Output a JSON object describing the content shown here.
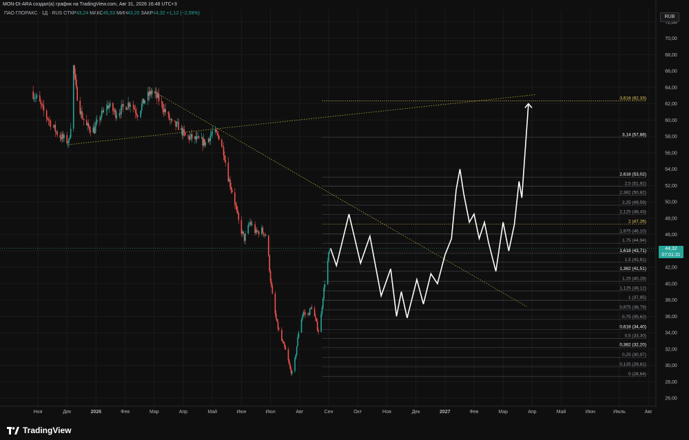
{
  "header": {
    "attribution": "MON-DI-ARA создал(а) график на TradingView.com, Авг 31, 2026 16:48 UTC+3"
  },
  "legend": {
    "symbol": "ПАО ГЛОРАКС · 1Д · RUS",
    "open_label": "ОТКР",
    "open": "43,24",
    "high_label": "МАКС",
    "high": "45,53",
    "low_label": "МИН",
    "low": "43,20",
    "close_label": "ЗАКР",
    "close": "44,32",
    "change": "+1,12 (+2,59%)"
  },
  "currency_button": "RUB",
  "price_badge": {
    "price": "44,32",
    "countdown": "07:01:31"
  },
  "footer": {
    "brand": "TradingView"
  },
  "colors": {
    "up": "#26a69a",
    "down": "#ef5350",
    "background": "#0f0f0f",
    "fib_gold": "#f0d060",
    "trend": "#b9b340",
    "projection": "#ffffff"
  },
  "chart_data": {
    "type": "candlestick",
    "y_axis": {
      "min": 25,
      "max": 73.5,
      "ticks": [
        "72,00",
        "70,00",
        "68,00",
        "66,00",
        "64,00",
        "62,00",
        "60,00",
        "58,00",
        "56,00",
        "54,00",
        "52,00",
        "50,00",
        "48,00",
        "46,00",
        "44,00",
        "42,00",
        "40,00",
        "38,00",
        "36,00",
        "34,00",
        "32,00",
        "30,00",
        "28,00",
        "26,00"
      ],
      "tick_values": [
        72,
        70,
        68,
        66,
        64,
        62,
        60,
        58,
        56,
        54,
        52,
        50,
        48,
        46,
        44,
        42,
        40,
        38,
        36,
        34,
        32,
        30,
        28,
        26
      ]
    },
    "x_axis": {
      "labels": [
        "Ноя",
        "Дек",
        "2026",
        "Фев",
        "Мар",
        "Апр",
        "Май",
        "Июн",
        "Июл",
        "Авг",
        "Сен",
        "Окт",
        "Ноя",
        "Дек",
        "2027",
        "Фев",
        "Мар",
        "Апр",
        "Май",
        "Июн",
        "Июль",
        "Авг"
      ],
      "label_months": [
        0,
        1,
        2,
        3,
        4,
        5,
        6,
        7,
        8,
        9,
        10,
        11,
        12,
        13,
        14,
        15,
        16,
        17,
        18,
        19,
        20,
        21
      ],
      "bold_labels": [
        "2026",
        "2027"
      ],
      "month_start": "2025-11",
      "month_end": "2027-08"
    },
    "price_path": [
      [
        "2025-10-25",
        63.5
      ],
      [
        "2025-11-01",
        62.5
      ],
      [
        "2025-11-08",
        60.8
      ],
      [
        "2025-11-15",
        59.5
      ],
      [
        "2025-11-22",
        58.2
      ],
      [
        "2025-11-29",
        57.6
      ],
      [
        "2025-12-03",
        57.3
      ],
      [
        "2025-12-06",
        60.5
      ],
      [
        "2025-12-08",
        66.5
      ],
      [
        "2025-12-11",
        63.5
      ],
      [
        "2025-12-16",
        60.8
      ],
      [
        "2025-12-22",
        59.2
      ],
      [
        "2025-12-30",
        58.8
      ],
      [
        "2026-01-06",
        60.5
      ],
      [
        "2026-01-14",
        61.8
      ],
      [
        "2026-01-22",
        60.8
      ],
      [
        "2026-01-30",
        61.5
      ],
      [
        "2026-02-06",
        62.2
      ],
      [
        "2026-02-13",
        60.8
      ],
      [
        "2026-02-20",
        62.5
      ],
      [
        "2026-02-27",
        63.5
      ],
      [
        "2026-03-06",
        62.5
      ],
      [
        "2026-03-13",
        61.0
      ],
      [
        "2026-03-20",
        59.5
      ],
      [
        "2026-03-27",
        59.2
      ],
      [
        "2026-04-03",
        58.0
      ],
      [
        "2026-04-10",
        57.8
      ],
      [
        "2026-04-17",
        57.5
      ],
      [
        "2026-04-24",
        57.2
      ],
      [
        "2026-05-01",
        58.5
      ],
      [
        "2026-05-08",
        58.0
      ],
      [
        "2026-05-13",
        56.2
      ],
      [
        "2026-05-18",
        53.0
      ],
      [
        "2026-05-24",
        50.5
      ],
      [
        "2026-05-30",
        47.0
      ],
      [
        "2026-06-04",
        45.5
      ],
      [
        "2026-06-10",
        47.5
      ],
      [
        "2026-06-16",
        46.2
      ],
      [
        "2026-06-22",
        46.5
      ],
      [
        "2026-06-27",
        45.8
      ],
      [
        "2026-07-01",
        40.5
      ],
      [
        "2026-07-04",
        37.5
      ],
      [
        "2026-07-08",
        35.0
      ],
      [
        "2026-07-13",
        33.0
      ],
      [
        "2026-07-18",
        31.5
      ],
      [
        "2026-07-22",
        29.5
      ],
      [
        "2026-07-25",
        28.8
      ],
      [
        "2026-07-28",
        31.5
      ],
      [
        "2026-08-01",
        35.0
      ],
      [
        "2026-08-05",
        36.5
      ],
      [
        "2026-08-09",
        36.0
      ],
      [
        "2026-08-14",
        37.2
      ],
      [
        "2026-08-18",
        35.5
      ],
      [
        "2026-08-22",
        33.8
      ],
      [
        "2026-08-26",
        38.5
      ],
      [
        "2026-08-29",
        41.0
      ],
      [
        "2026-09-01",
        43.5
      ],
      [
        "2026-09-03",
        44.32
      ]
    ],
    "last_price": 44.32,
    "fib_levels": [
      {
        "ratio": "0",
        "price": "28,64",
        "value": 28.64,
        "emphasis": "normal"
      },
      {
        "ratio": "0,125",
        "price": "29,81",
        "value": 29.81,
        "emphasis": "normal"
      },
      {
        "ratio": "0,25",
        "price": "30,97",
        "value": 30.97,
        "emphasis": "normal"
      },
      {
        "ratio": "0,382",
        "price": "32,20",
        "value": 32.2,
        "emphasis": "bold"
      },
      {
        "ratio": "0,5",
        "price": "33,30",
        "value": 33.3,
        "emphasis": "normal"
      },
      {
        "ratio": "0,618",
        "price": "34,40",
        "value": 34.4,
        "emphasis": "bold"
      },
      {
        "ratio": "0,75",
        "price": "35,62",
        "value": 35.62,
        "emphasis": "normal"
      },
      {
        "ratio": "0,875",
        "price": "36,79",
        "value": 36.79,
        "emphasis": "normal"
      },
      {
        "ratio": "1",
        "price": "37,95",
        "value": 37.95,
        "emphasis": "normal"
      },
      {
        "ratio": "1,125",
        "price": "39,12",
        "value": 39.12,
        "emphasis": "normal"
      },
      {
        "ratio": "1,25",
        "price": "40,28",
        "value": 40.28,
        "emphasis": "normal"
      },
      {
        "ratio": "1,382",
        "price": "41,51",
        "value": 41.51,
        "emphasis": "bold"
      },
      {
        "ratio": "1,5",
        "price": "42,61",
        "value": 42.61,
        "emphasis": "normal"
      },
      {
        "ratio": "1,618",
        "price": "43,71",
        "value": 43.71,
        "emphasis": "bold"
      },
      {
        "ratio": "1,75",
        "price": "44,94",
        "value": 44.94,
        "emphasis": "normal"
      },
      {
        "ratio": "1,875",
        "price": "46,10",
        "value": 46.1,
        "emphasis": "normal"
      },
      {
        "ratio": "2",
        "price": "47,26",
        "value": 47.26,
        "emphasis": "gold"
      },
      {
        "ratio": "2,125",
        "price": "48,43",
        "value": 48.43,
        "emphasis": "normal"
      },
      {
        "ratio": "2,25",
        "price": "49,59",
        "value": 49.59,
        "emphasis": "normal"
      },
      {
        "ratio": "2,382",
        "price": "50,82",
        "value": 50.82,
        "emphasis": "normal"
      },
      {
        "ratio": "2,5",
        "price": "51,92",
        "value": 51.92,
        "emphasis": "normal"
      },
      {
        "ratio": "2,618",
        "price": "53,02",
        "value": 53.02,
        "emphasis": "bold"
      },
      {
        "ratio": "3,14",
        "price": "57,88",
        "value": 57.88,
        "emphasis": "bold"
      },
      {
        "ratio": "3,618",
        "price": "62,33",
        "value": 62.33,
        "emphasis": "gold"
      }
    ],
    "fib_start": "2026-08-25",
    "trendlines": [
      {
        "name": "falling",
        "from": [
          "2026-02-27",
          63.6
        ],
        "to": [
          "2027-03-26",
          37.2
        ]
      },
      {
        "name": "rising",
        "from": [
          "2025-12-03",
          57.0
        ],
        "to": [
          "2027-04-04",
          63.1
        ]
      }
    ],
    "projection": [
      [
        "2026-09-03",
        44.32
      ],
      [
        "2026-09-09",
        42.2
      ],
      [
        "2026-09-22",
        48.5
      ],
      [
        "2026-10-04",
        42.5
      ],
      [
        "2026-10-14",
        45.8
      ],
      [
        "2026-10-26",
        38.5
      ],
      [
        "2026-11-05",
        41.8
      ],
      [
        "2026-11-11",
        36.0
      ],
      [
        "2026-11-16",
        39.0
      ],
      [
        "2026-11-22",
        35.8
      ],
      [
        "2026-12-02",
        40.5
      ],
      [
        "2026-12-09",
        37.5
      ],
      [
        "2026-12-17",
        41.2
      ],
      [
        "2026-12-24",
        40.0
      ],
      [
        "2027-01-01",
        43.5
      ],
      [
        "2027-01-08",
        45.5
      ],
      [
        "2027-01-13",
        51.5
      ],
      [
        "2027-01-17",
        54.0
      ],
      [
        "2027-01-21",
        51.0
      ],
      [
        "2027-01-27",
        47.5
      ],
      [
        "2027-02-01",
        48.5
      ],
      [
        "2027-02-06",
        45.5
      ],
      [
        "2027-02-11",
        47.5
      ],
      [
        "2027-02-15",
        45.0
      ],
      [
        "2027-02-22",
        41.5
      ],
      [
        "2027-03-01",
        47.5
      ],
      [
        "2027-03-07",
        44.0
      ],
      [
        "2027-03-13",
        47.2
      ],
      [
        "2027-03-18",
        52.5
      ],
      [
        "2027-03-21",
        50.5
      ],
      [
        "2027-03-28",
        62.0
      ]
    ]
  }
}
